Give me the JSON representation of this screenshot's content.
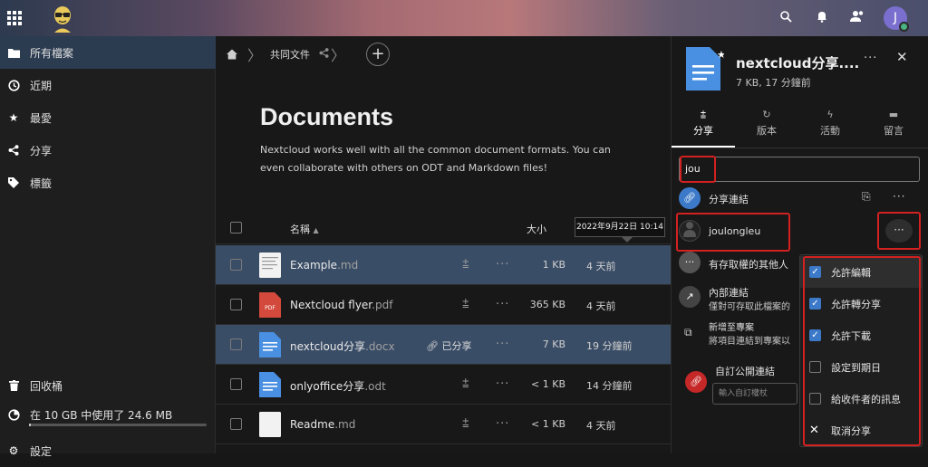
{
  "header": {
    "icons": [
      "app-grid-icon",
      "search-icon",
      "bell-icon",
      "contacts-icon"
    ],
    "avatar_initial": "J"
  },
  "sidebar": {
    "items": [
      {
        "label": "所有檔案",
        "icon": "folder-icon"
      },
      {
        "label": "近期",
        "icon": "clock-icon"
      },
      {
        "label": "最愛",
        "icon": "star-icon"
      },
      {
        "label": "分享",
        "icon": "share-icon"
      },
      {
        "label": "標籤",
        "icon": "tag-icon"
      }
    ],
    "trash_label": "回收桶",
    "quota_label": "在 10 GB 中使用了 24.6 MB",
    "quota_used_fraction": 0.0024,
    "settings_label": "設定"
  },
  "main": {
    "breadcrumb": "共同文件",
    "title": "Documents",
    "description": "Nextcloud works well with all the common document formats. You can even collaborate with others on ODT and Markdown files!",
    "columns": {
      "name": "名稱",
      "size": "大小"
    },
    "tooltip": "2022年9月22日 10:14",
    "files": [
      {
        "base": "Example",
        "ext": ".md",
        "size": "1 KB",
        "date": "4 天前",
        "shared_label": "",
        "icon": "text-file-icon"
      },
      {
        "base": "Nextcloud flyer",
        "ext": ".pdf",
        "size": "365 KB",
        "date": "4 天前",
        "shared_label": "",
        "icon": "pdf-file-icon"
      },
      {
        "base": "nextcloud分享",
        "ext": ".docx",
        "size": "7 KB",
        "date": "19 分鐘前",
        "shared_label": "已分享",
        "icon": "document-icon"
      },
      {
        "base": "onlyoffice分享",
        "ext": ".odt",
        "size": "< 1 KB",
        "date": "14 分鐘前",
        "shared_label": "",
        "icon": "document-icon"
      },
      {
        "base": "Readme",
        "ext": ".md",
        "size": "< 1 KB",
        "date": "4 天前",
        "shared_label": "",
        "icon": "text-file-icon"
      }
    ]
  },
  "panel": {
    "title": "nextcloud分享....",
    "subtitle": "7 KB, 17 分鐘前",
    "tabs": [
      "分享",
      "版本",
      "活動",
      "留言"
    ],
    "search_value": "jou",
    "share_link_label": "分享連結",
    "user_name": "joulongleu",
    "others_label": "有存取權的其他人",
    "internal_link_title": "內部連結",
    "internal_link_desc": "僅對可存取此檔案的",
    "project_title": "新增至專案",
    "project_desc": "將項目連結到專案以",
    "custom_link_label": "自訂公開連結",
    "password_placeholder": "輸入自訂權杖",
    "menu": [
      {
        "label": "允許編輯",
        "checked": true
      },
      {
        "label": "允許轉分享",
        "checked": true
      },
      {
        "label": "允許下載",
        "checked": true
      },
      {
        "label": "設定到期日",
        "checked": false
      },
      {
        "label": "給收件者的訊息",
        "checked": false
      },
      {
        "label": "取消分享",
        "checked": null
      }
    ]
  },
  "colors": {
    "accent": "#3c7ac9",
    "highlight_red": "#d32020",
    "selected_row": "#3a4d66"
  }
}
